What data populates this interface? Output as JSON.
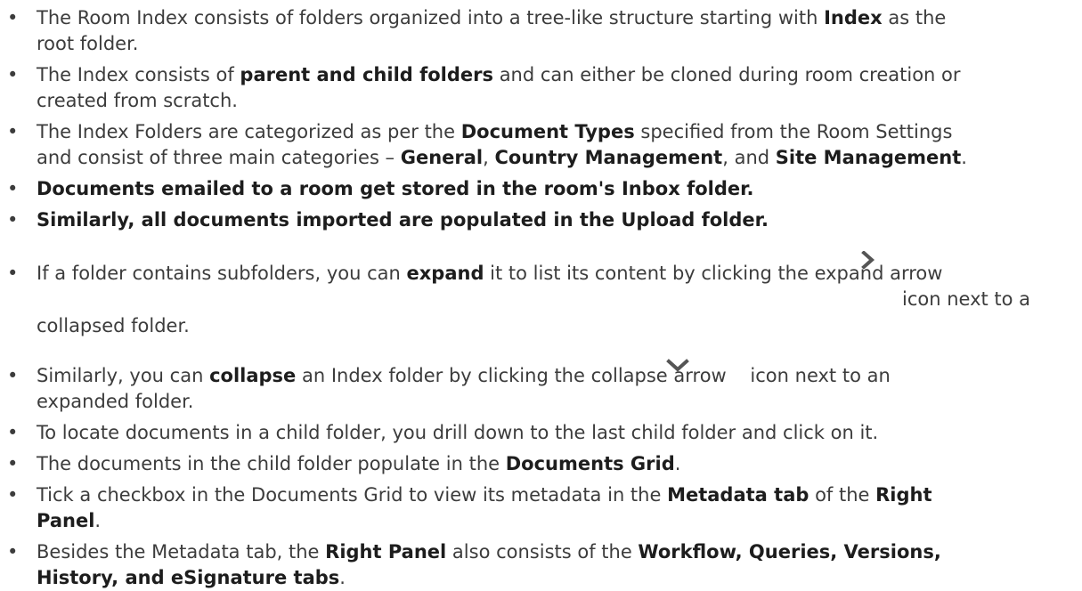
{
  "bullet_glyph": "•",
  "items": {
    "i1": {
      "a": "The Room Index consists of folders organized into a tree-like structure starting with ",
      "b1": "Index",
      "c": " as the",
      "d": "root folder."
    },
    "i2": {
      "a": "The Index consists of ",
      "b1": "parent and child folders",
      "c": " and can either be cloned during room creation or",
      "d": "created from scratch."
    },
    "i3": {
      "a": "The Index Folders are categorized as per the ",
      "b1": "Document Types",
      "c": " specified from the Room Settings",
      "d": "and consist of three main categories – ",
      "b2": "General",
      "e": ", ",
      "b3": "Country Management",
      "f": ", and ",
      "b4": "Site Management",
      "g": "."
    },
    "i4": {
      "a": "Documents emailed to a room get stored in the room's Inbox folder."
    },
    "i5": {
      "a": "Similarly, all documents imported are populated in the Upload folder."
    },
    "i6": {
      "a": "If a folder contains subfolders, you can ",
      "b1": "expand",
      "c": " it to list its content by clicking the expand arrow",
      "d": "icon next to a",
      "e": "collapsed folder."
    },
    "i7": {
      "a": "Similarly, you can ",
      "b1": "collapse",
      "c": " an Index folder by clicking the collapse arrow    icon next to an",
      "d": "expanded folder."
    },
    "i8": {
      "a": "To locate documents in a child folder, you drill down to the last child folder and click on it."
    },
    "i9": {
      "a": "The documents in the child folder populate in the ",
      "b1": "Documents Grid",
      "c": "."
    },
    "i10": {
      "a": "Tick a checkbox in the Documents Grid to view its metadata in the ",
      "b1": "Metadata tab",
      "c": " of the ",
      "b2": "Right",
      "d": "Panel",
      "e": "."
    },
    "i11": {
      "a": "Besides the Metadata tab, the ",
      "b1": "Right Panel",
      "c": " also consists of the ",
      "b2": "Workflow, Queries, Versions,",
      "d": "History, and eSignature tabs",
      "e": "."
    }
  },
  "icons": {
    "expand": "chevron-right-icon",
    "collapse": "chevron-down-icon",
    "icon_color": "#555555"
  }
}
